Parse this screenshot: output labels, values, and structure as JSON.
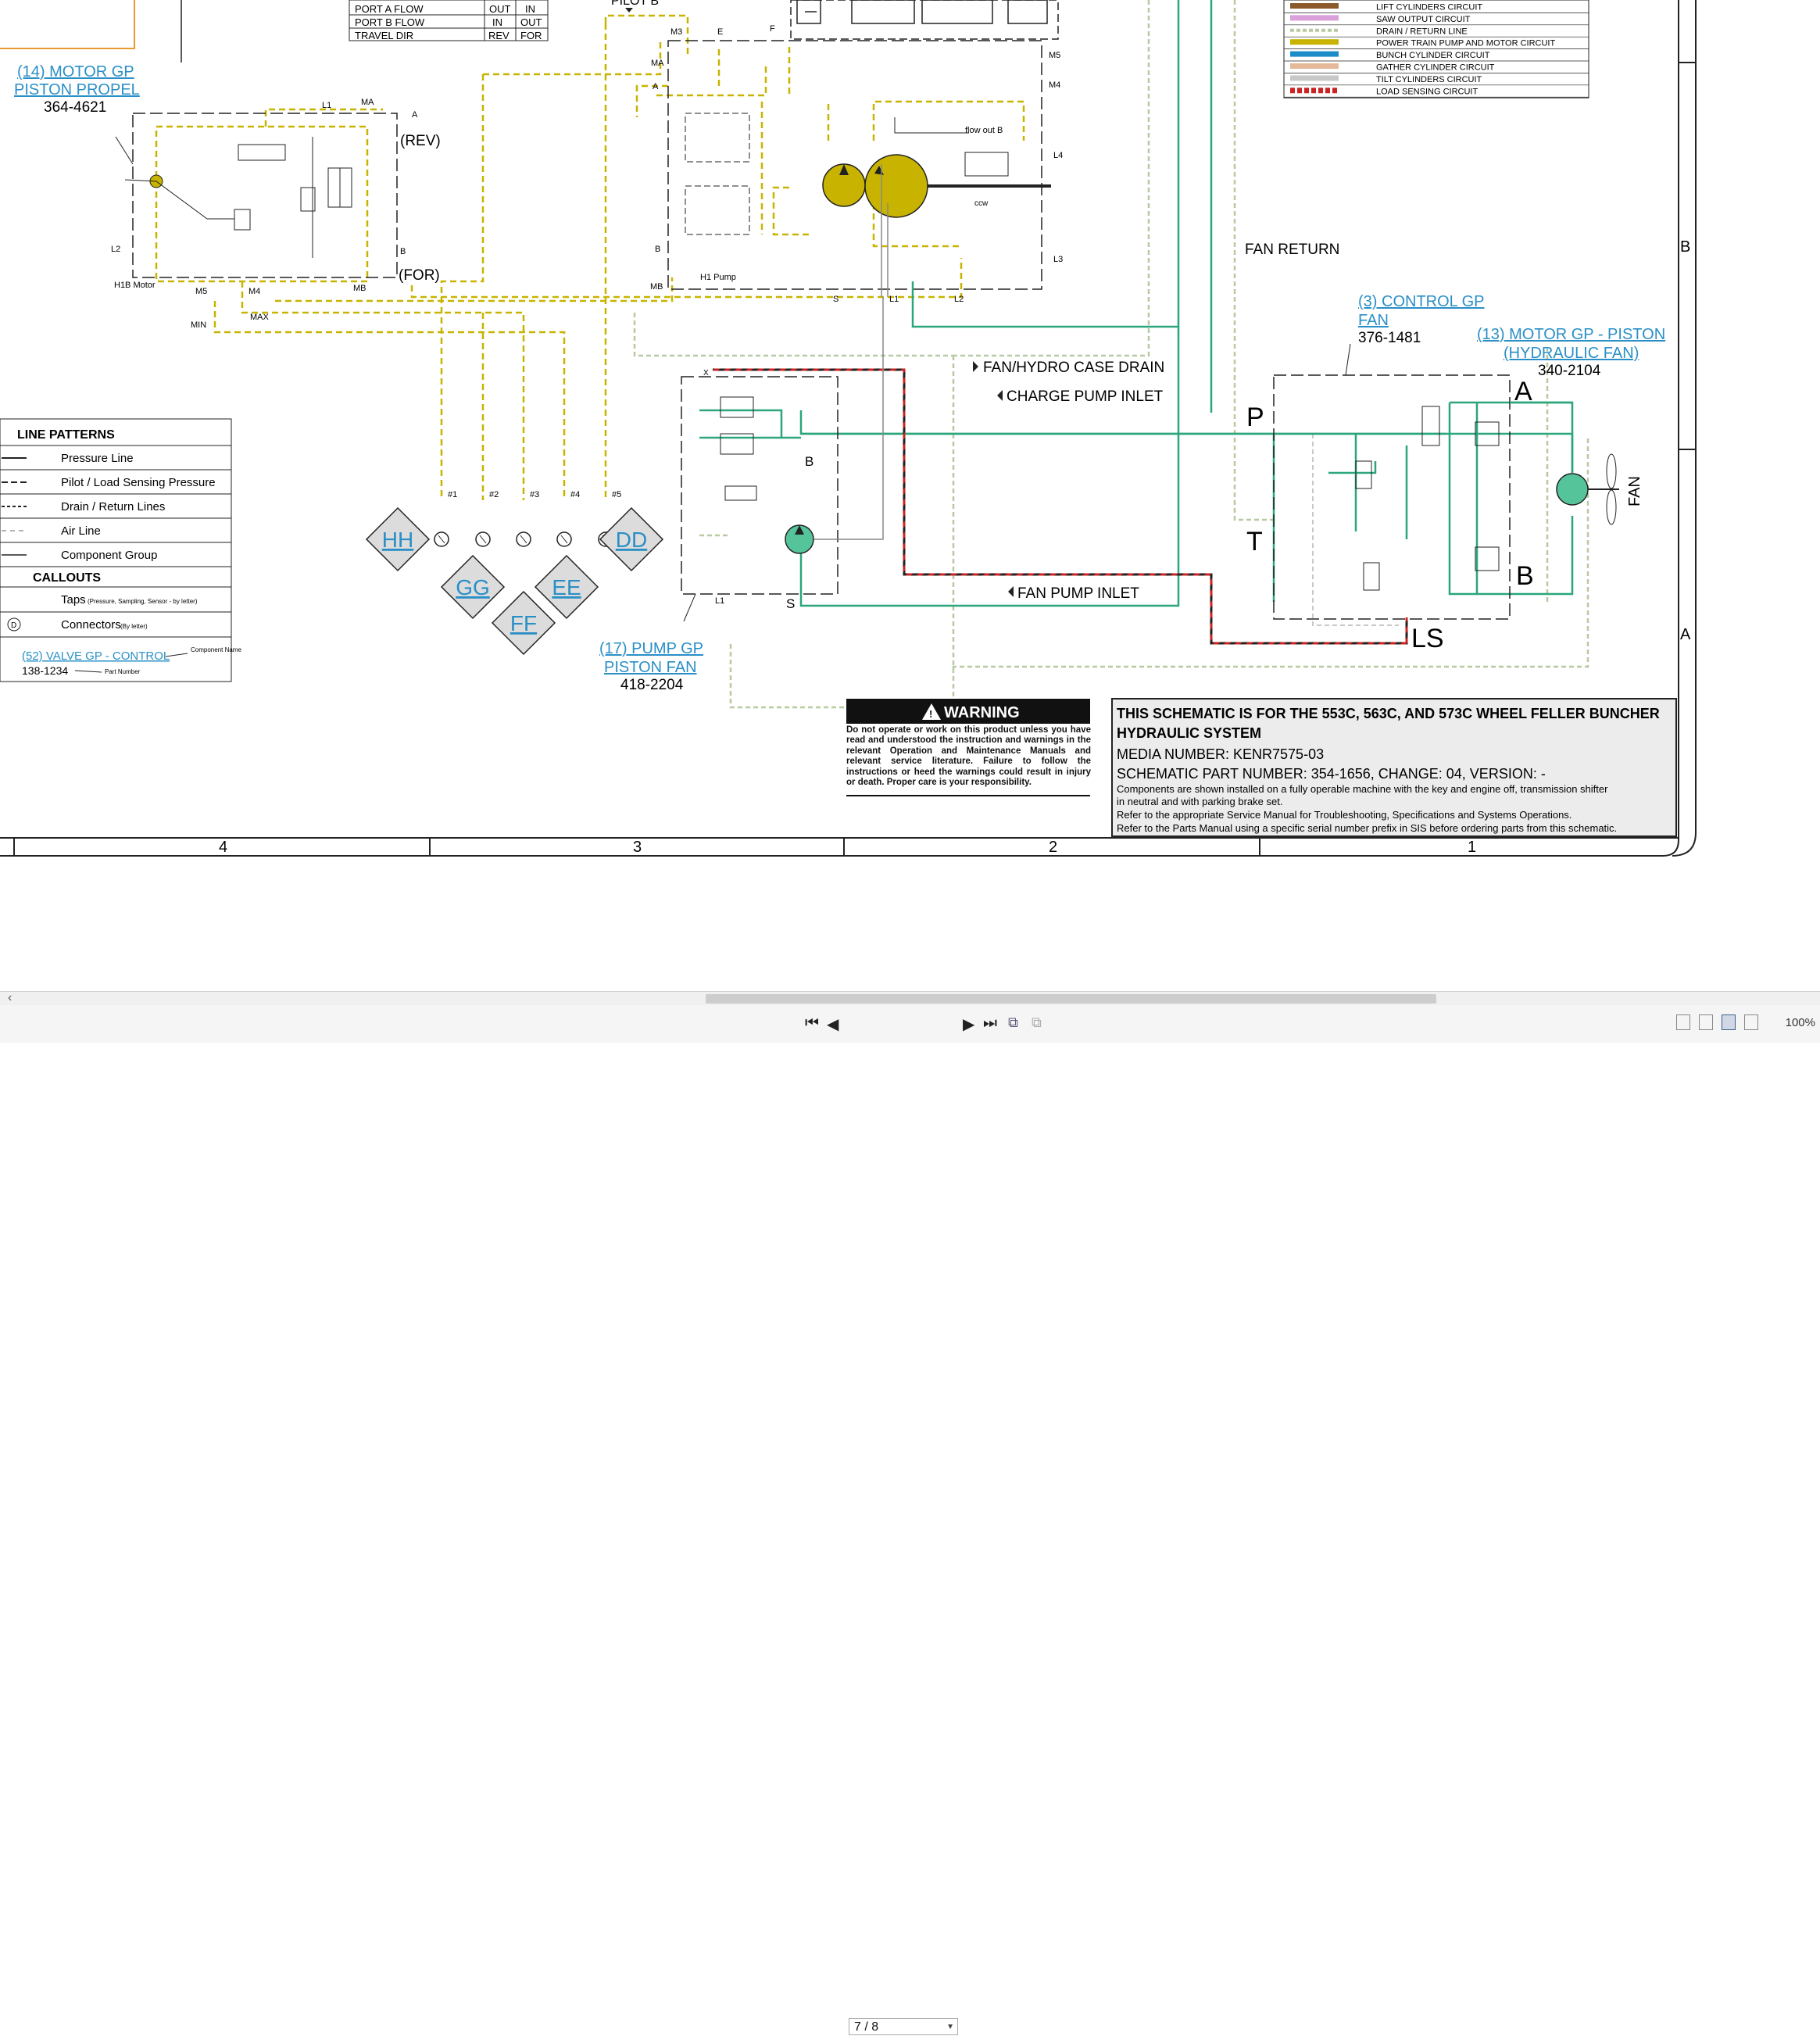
{
  "table_top": [
    {
      "label": "PORT A FLOW",
      "a": "OUT",
      "b": "IN"
    },
    {
      "label": "PORT B FLOW",
      "a": "IN",
      "b": "OUT"
    },
    {
      "label": "TRAVEL DIR",
      "a": "REV",
      "b": "FOR"
    }
  ],
  "pilot_b": "PILOT B",
  "motor_propel": {
    "title1": "(14) MOTOR GP",
    "title2": "PISTON PROPEL",
    "part": "364-4621",
    "name": "H1B Motor",
    "rev": "(REV)",
    "for": "(FOR)"
  },
  "pump_h1": {
    "name": "H1 Pump",
    "flow_out": "flow out B",
    "ccw": "ccw"
  },
  "port_labels": {
    "L1": "L1",
    "MA": "MA",
    "A": "A",
    "B": "B",
    "L2": "L2",
    "M5": "M5",
    "M4": "M4",
    "MB": "MB",
    "MIN": "MIN",
    "MAX": "MAX",
    "M3": "M3",
    "E": "E",
    "F": "F",
    "L4": "L4",
    "L3": "L3",
    "S": "S",
    "X": "X"
  },
  "drains": {
    "fan_return": "FAN RETURN",
    "fan_hydro_case_drain": "FAN/HYDRO CASE DRAIN",
    "charge_pump_inlet": "CHARGE PUMP INLET",
    "fan_pump_inlet": "FAN PUMP INLET"
  },
  "control_fan": {
    "title1": "(3) CONTROL GP",
    "title2": "FAN",
    "part": "376-1481",
    "P": "P",
    "T": "T",
    "A": "A",
    "B": "B",
    "LS": "LS"
  },
  "motor_fan": {
    "title1": "(13) MOTOR GP - PISTON",
    "title2": "(HYDRAULIC FAN)",
    "part": "340-2104",
    "fan": "FAN"
  },
  "pump_fan": {
    "title1": "(17) PUMP GP",
    "title2": "PISTON FAN",
    "part": "418-2204"
  },
  "taps": [
    "HH",
    "GG",
    "FF",
    "EE",
    "DD"
  ],
  "tap_nums": [
    "#1",
    "#2",
    "#3",
    "#4",
    "#5"
  ],
  "legend_colors": [
    {
      "label": "LIFT CYLINDERS CIRCUIT",
      "color": "#8b5a2b",
      "dashed": false
    },
    {
      "label": "SAW OUTPUT CIRCUIT",
      "color": "#d9a0d9",
      "dashed": false
    },
    {
      "label": "DRAIN / RETURN LINE",
      "color": "#b7c9a0",
      "dashed": true
    },
    {
      "label": "POWER TRAIN PUMP AND MOTOR CIRCUIT",
      "color": "#c8b400",
      "dashed": false
    },
    {
      "label": "BUNCH CYLINDER CIRCUIT",
      "color": "#1a8cc8",
      "dashed": false
    },
    {
      "label": "GATHER CYLINDER CIRCUIT",
      "color": "#e3b99a",
      "dashed": false
    },
    {
      "label": "TILT CYLINDERS CIRCUIT",
      "color": "#c8c8c8",
      "dashed": false
    },
    {
      "label": "LOAD SENSING CIRCUIT",
      "color": "#cc2222",
      "dashed": true
    }
  ],
  "line_patterns": {
    "title": "LINE PATTERNS",
    "items": [
      "Pressure Line",
      "Pilot / Load Sensing Pressure",
      "Drain / Return Lines",
      "Air Line",
      "Component Group"
    ],
    "callouts_title": "CALLOUTS",
    "taps": "Taps",
    "taps_note": "(Pressure, Sampling, Sensor - by letter)",
    "connectors": "Connectors",
    "connectors_note": "(By letter)",
    "connector_letter": "D",
    "example_name": "(52) VALVE GP - CONTROL",
    "example_part": "138-1234",
    "component_name": "Component Name",
    "part_number": "Part Number"
  },
  "warning": {
    "title": "WARNING",
    "text": "Do not operate or work on this product unless you have read and understood the instruction and warnings in the relevant Operation and Maintenance Manuals and relevant service literature. Failure to follow the instructions or heed the warnings could result in injury or death. Proper care is your responsibility."
  },
  "info": {
    "title": "THIS SCHEMATIC IS FOR THE 553C, 563C, AND 573C WHEEL FELLER BUNCHER HYDRAULIC SYSTEM",
    "media": "MEDIA NUMBER: KENR7575-03",
    "part": "SCHEMATIC PART NUMBER: 354-1656, CHANGE: 04, VERSION: -",
    "note1": "Components are shown installed on a fully operable machine with the key and engine off, transmission shifter",
    "note2": "in neutral and with parking brake set.",
    "note3": "Refer to the appropriate Service Manual for Troubleshooting, Specifications and Systems Operations.",
    "note4": "Refer to the Parts Manual using a specific serial number prefix in SIS before ordering parts from this schematic."
  },
  "grid": {
    "cols": [
      "4",
      "3",
      "2",
      "1"
    ],
    "rows": [
      "B",
      "A"
    ]
  },
  "viewer": {
    "page": "7 / 8",
    "zoom": "100%"
  }
}
